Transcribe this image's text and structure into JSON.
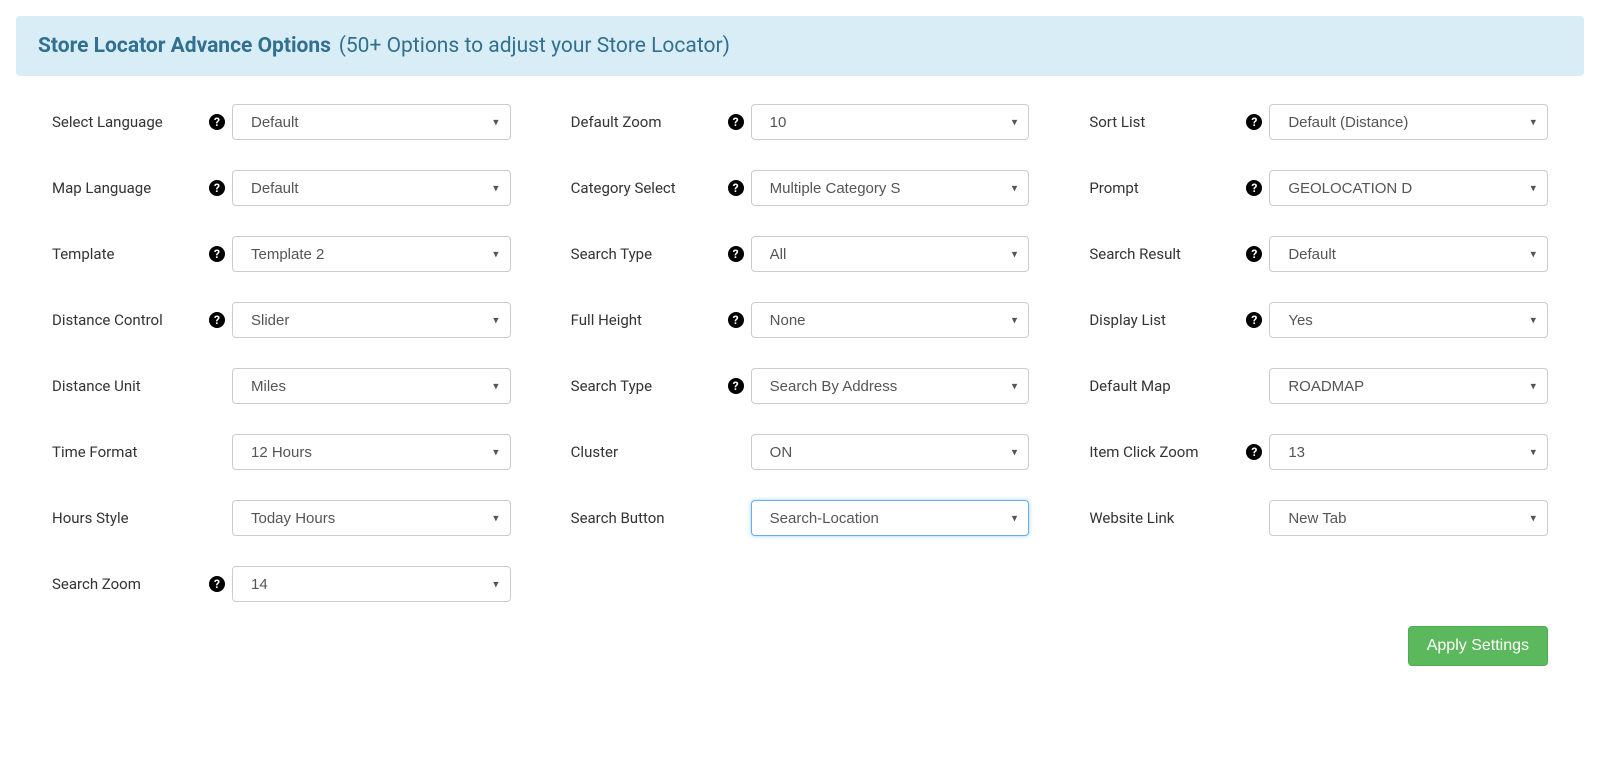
{
  "header": {
    "title": "Store Locator Advance Options",
    "subtitle": "(50+ Options to adjust your Store Locator)"
  },
  "columns": {
    "col1": [
      {
        "label": "Select Language",
        "value": "Default",
        "help": true,
        "name": "select-language"
      },
      {
        "label": "Map Language",
        "value": "Default",
        "help": true,
        "name": "map-language"
      },
      {
        "label": "Template",
        "value": "Template 2",
        "help": true,
        "name": "template"
      },
      {
        "label": "Distance Control",
        "value": "Slider",
        "help": true,
        "name": "distance-control"
      },
      {
        "label": "Distance Unit",
        "value": "Miles",
        "help": false,
        "name": "distance-unit"
      },
      {
        "label": "Time Format",
        "value": "12 Hours",
        "help": false,
        "name": "time-format"
      },
      {
        "label": "Hours Style",
        "value": "Today Hours",
        "help": false,
        "name": "hours-style"
      },
      {
        "label": "Search Zoom",
        "value": "14",
        "help": true,
        "name": "search-zoom"
      }
    ],
    "col2": [
      {
        "label": "Default Zoom",
        "value": "10",
        "help": true,
        "name": "default-zoom"
      },
      {
        "label": "Category Select",
        "value": "Multiple Category S",
        "help": true,
        "name": "category-select"
      },
      {
        "label": "Search Type",
        "value": "All",
        "help": true,
        "name": "search-type-all"
      },
      {
        "label": "Full Height",
        "value": "None",
        "help": true,
        "name": "full-height"
      },
      {
        "label": "Search Type",
        "value": "Search By Address",
        "help": true,
        "name": "search-type-address"
      },
      {
        "label": "Cluster",
        "value": "ON",
        "help": false,
        "name": "cluster"
      },
      {
        "label": "Search Button",
        "value": "Search-Location",
        "help": false,
        "name": "search-button",
        "focused": true
      }
    ],
    "col3": [
      {
        "label": "Sort List",
        "value": "Default (Distance)",
        "help": true,
        "name": "sort-list"
      },
      {
        "label": "Prompt",
        "value": "GEOLOCATION D",
        "help": true,
        "name": "prompt"
      },
      {
        "label": "Search Result",
        "value": "Default",
        "help": true,
        "name": "search-result"
      },
      {
        "label": "Display List",
        "value": "Yes",
        "help": true,
        "name": "display-list"
      },
      {
        "label": "Default Map",
        "value": "ROADMAP",
        "help": false,
        "name": "default-map"
      },
      {
        "label": "Item Click Zoom",
        "value": "13",
        "help": true,
        "name": "item-click-zoom"
      },
      {
        "label": "Website Link",
        "value": "New Tab",
        "help": false,
        "name": "website-link"
      }
    ]
  },
  "footer": {
    "apply_label": "Apply Settings"
  }
}
